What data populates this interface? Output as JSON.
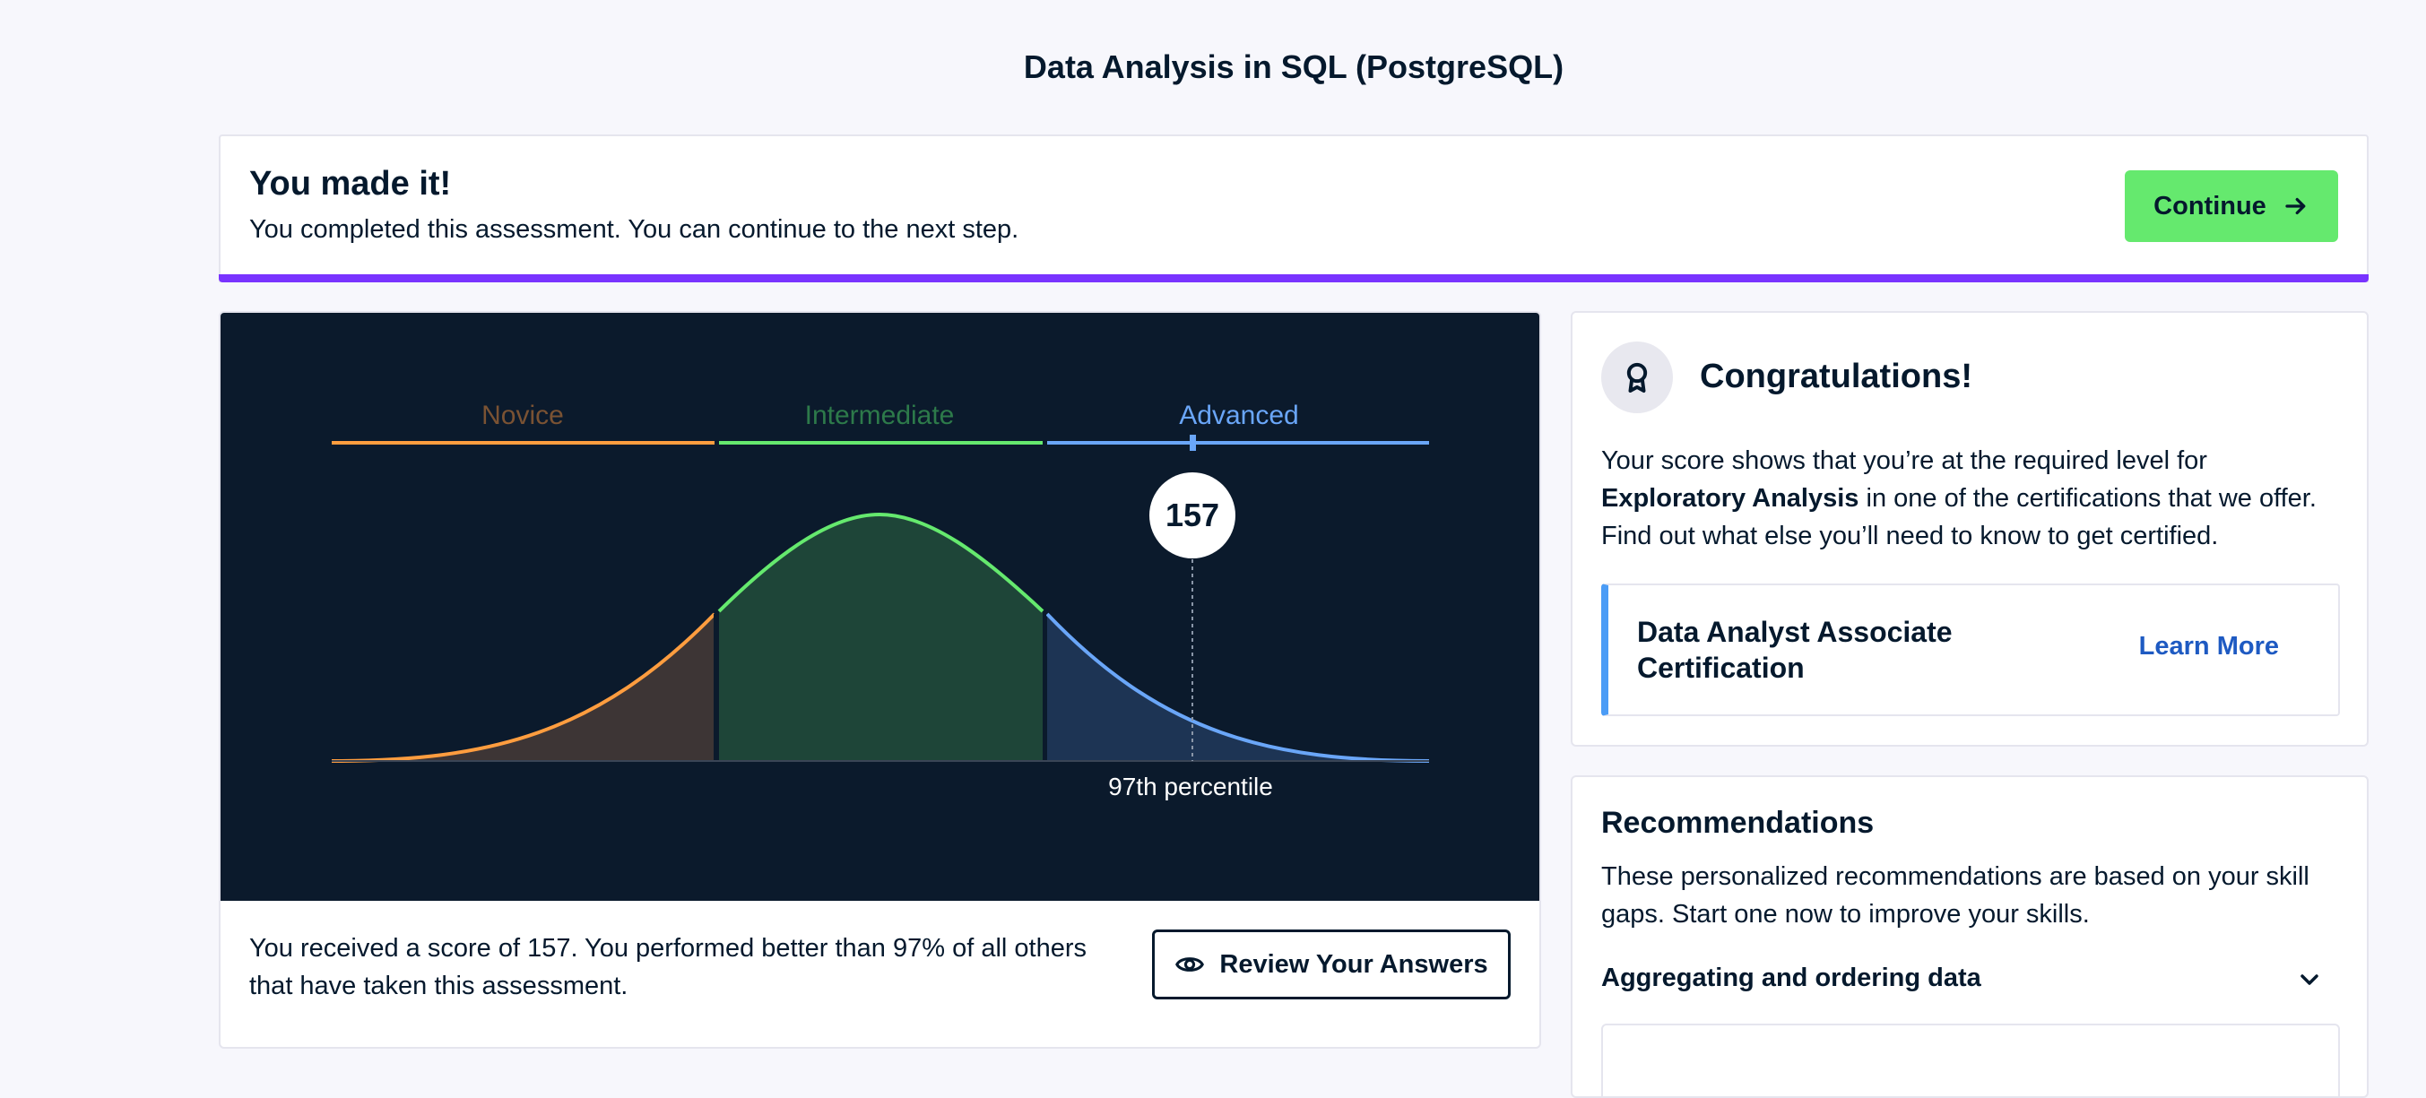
{
  "page": {
    "title": "Data Analysis in SQL (PostgreSQL)"
  },
  "banner": {
    "title": "You made it!",
    "text": "You completed this assessment. You can continue to the next step.",
    "continue_label": "Continue"
  },
  "chart_data": {
    "type": "area",
    "levels": [
      {
        "label": "Novice",
        "color": "#ff9d3f"
      },
      {
        "label": "Intermediate",
        "color": "#65e96e"
      },
      {
        "label": "Advanced",
        "color": "#6aa6f8"
      }
    ],
    "score": "157",
    "percentile_label": "97th percentile"
  },
  "result": {
    "score_text": "You received a score of 157. You performed better than 97% of all others that have taken this assessment.",
    "review_label": "Review Your Answers"
  },
  "congrats": {
    "title": "Congratulations!",
    "text_before": "Your score shows that you’re at the required level for ",
    "text_bold": "Exploratory Analysis",
    "text_after": " in one of the certifications that we offer. Find out what else you’ll need to know to get certified.",
    "cert_name": "Data Analyst Associate Certification",
    "learn_more": "Learn More"
  },
  "recommendations": {
    "title": "Recommendations",
    "text": "These personalized recommendations are based on your skill gaps. Start one now to improve your skills.",
    "item_label": "Aggregating and ordering data"
  },
  "colors": {
    "accent": "#7933ff",
    "continue_bg": "#65e96e",
    "chart_bg": "#0b1a2c",
    "link": "#1e5ac2"
  }
}
